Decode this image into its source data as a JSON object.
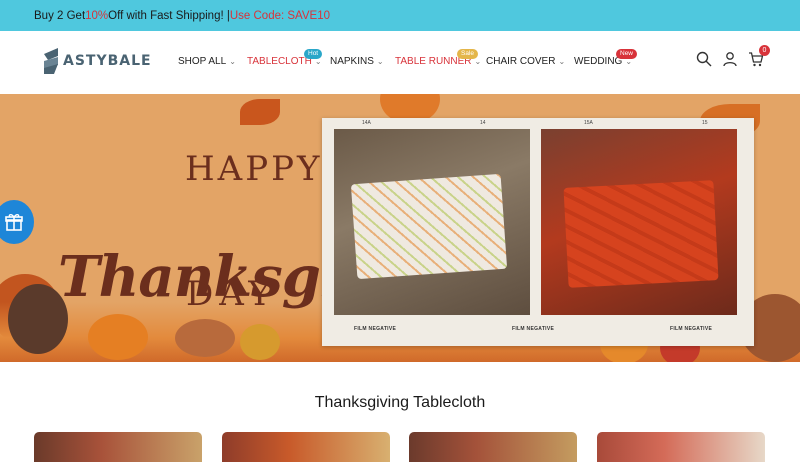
{
  "promo": {
    "prefix": "Buy 2 Get ",
    "discount": "10%",
    "middle": " Off with Fast Shipping! | ",
    "code": "Use Code: SAVE10"
  },
  "brand": {
    "name": "ASTYBALE",
    "logo_letter": "S"
  },
  "nav": {
    "items": [
      {
        "label": "SHOP ALL",
        "badge": ""
      },
      {
        "label": "TABLECLOTH",
        "badge": "Hot"
      },
      {
        "label": "NAPKINS",
        "badge": ""
      },
      {
        "label": "TABLE RUNNER",
        "badge": "Sale"
      },
      {
        "label": "CHAIR COVER",
        "badge": ""
      },
      {
        "label": "WEDDING",
        "badge": "New"
      }
    ]
  },
  "header_icons": {
    "search": "search-icon",
    "account": "user-icon",
    "cart": "cart-icon",
    "cart_count": "0"
  },
  "hero": {
    "line1": "HAPPY",
    "line2": "Thanksgiving",
    "line3": "DAY",
    "film_label": "FILM NEGATIVE",
    "film_top_left_a": "14A",
    "film_top_left_b": "14",
    "film_top_right_a": "15A",
    "film_top_right_b": "15"
  },
  "section": {
    "title": "Thanksgiving Tablecloth"
  },
  "colors": {
    "promo_bg": "#4fc8de",
    "accent_red": "#d8333a",
    "badge_hot": "#2aa7c9",
    "badge_sale": "#e4b64a",
    "badge_new": "#d8333a",
    "gift_button": "#1e86d8"
  },
  "floating": {
    "gift": "gift-icon"
  }
}
